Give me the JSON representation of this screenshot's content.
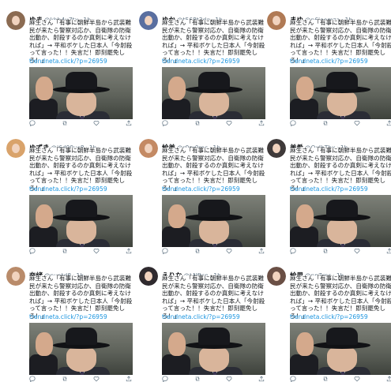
{
  "tweets": [
    {
      "name": "ゆま",
      "handle": "@kbh4u7tx",
      "time": "1h",
      "avatar_color": "#8b6b52"
    },
    {
      "name": "ゆか",
      "handle": "@t568t3dg",
      "time": "1h",
      "avatar_color": "#5a6fa0"
    },
    {
      "name": "まゆ",
      "handle": "@n6ioemza",
      "time": "1h",
      "avatar_color": "#b07a55"
    },
    {
      "name": "ゆずき",
      "handle": "@j6d99yc8",
      "time": "1h",
      "avatar_color": "#d9a36b"
    },
    {
      "name": "絵美",
      "handle": "@r9rx0rec",
      "time": "1h",
      "avatar_color": "#c48a64"
    },
    {
      "name": "美希",
      "handle": "@OxlhThx",
      "time": "1h",
      "avatar_color": "#3f3a3a"
    },
    {
      "name": "奈緒",
      "handle": "@nuotd8",
      "time": "1h",
      "avatar_color": "#b98b6a"
    },
    {
      "name": "えりな",
      "handle": "@LNftsn",
      "time": "1h",
      "avatar_color": "#2f2a2e"
    },
    {
      "name": "絵里",
      "handle": "@np7rns",
      "time": "1h",
      "avatar_color": "#6a4f45"
    }
  ],
  "tweet_text": "麻生さん「有事に朝鮮半島から武装難民が来たら警察対応か、自衛隊の防衛出動か、射殺するのか真剣に考えなければ」→ 平和ボケした日本人「今射殺って言った！！失言だ！即刻罷免しろ！」",
  "tweet_link": "trendneta.click/?p=26959",
  "separator": "·",
  "action_icons": [
    "reply-icon",
    "retweet-icon",
    "like-icon",
    "share-icon"
  ]
}
